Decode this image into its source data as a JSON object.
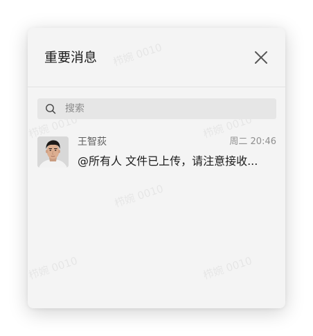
{
  "header": {
    "title": "重要消息"
  },
  "search": {
    "placeholder": "搜索"
  },
  "conversations": [
    {
      "name": "王智荻",
      "time": "周二 20:46",
      "message": "@所有人 文件已上传，请注意接收..."
    }
  ],
  "watermark": {
    "text": "栉婉 0010"
  }
}
